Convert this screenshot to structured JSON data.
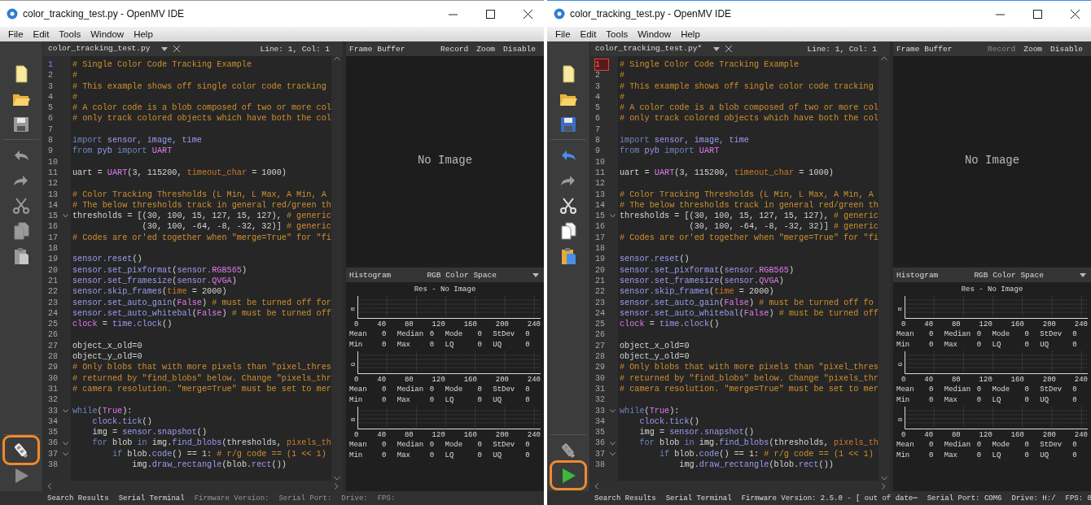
{
  "windows": [
    {
      "title": "color_tracking_test.py - OpenMV IDE",
      "active": false,
      "menu": [
        "File",
        "Edit",
        "Tools",
        "Window",
        "Help"
      ],
      "toolbar_top": [
        {
          "kind": "new-file",
          "enabled": true
        },
        {
          "kind": "open-folder",
          "enabled": true
        },
        {
          "kind": "save",
          "enabled": false
        },
        {
          "kind": "undo",
          "enabled": false
        },
        {
          "kind": "redo",
          "enabled": false
        },
        {
          "kind": "cut",
          "enabled": false
        },
        {
          "kind": "copy",
          "enabled": false
        },
        {
          "kind": "paste",
          "enabled": false
        }
      ],
      "toolbar_bottom": [
        {
          "kind": "connect",
          "enabled": true,
          "highlighted": true
        },
        {
          "kind": "run",
          "enabled": false,
          "highlighted": false
        }
      ],
      "editor": {
        "tab": "color_tracking_test.py",
        "position": "Line: 1, Col: 1",
        "focused": false,
        "lines": [
          {
            "number": "1",
            "current": true,
            "fold": false,
            "segments": [
              {
                "kind": "comment",
                "text": "# Single Color Code Tracking Example"
              }
            ]
          },
          {
            "number": "2",
            "current": false,
            "fold": false,
            "segments": [
              {
                "kind": "comment",
                "text": "#"
              }
            ]
          },
          {
            "number": "3",
            "current": false,
            "fold": false,
            "segments": [
              {
                "kind": "comment",
                "text": "# This example shows off single color code tracking"
              }
            ]
          },
          {
            "number": "4",
            "current": false,
            "fold": false,
            "segments": [
              {
                "kind": "comment",
                "text": "#"
              }
            ]
          },
          {
            "number": "5",
            "current": false,
            "fold": false,
            "segments": [
              {
                "kind": "comment",
                "text": "# A color code is a blob composed of two or more col"
              }
            ]
          },
          {
            "number": "6",
            "current": false,
            "fold": false,
            "segments": [
              {
                "kind": "comment",
                "text": "# only track colored objects which have both the col"
              }
            ]
          },
          {
            "number": "7",
            "current": false,
            "fold": false
          },
          {
            "number": "8",
            "current": false,
            "fold": false,
            "segments": [
              {
                "kind": "keyword",
                "text": "import"
              },
              {
                "kind": "module",
                "text": " sensor, image, time"
              }
            ]
          },
          {
            "number": "9",
            "current": false,
            "fold": false,
            "segments": [
              {
                "kind": "keyword",
                "text": "from"
              },
              {
                "kind": "module",
                "text": " pyb"
              },
              {
                "kind": "keyword",
                "text": " import"
              },
              {
                "kind": "constant",
                "text": " UART"
              }
            ]
          },
          {
            "number": "10",
            "current": false,
            "fold": false
          },
          {
            "number": "11",
            "current": false,
            "fold": false,
            "segments": [
              {
                "kind": "plain",
                "text": "uart = "
              },
              {
                "kind": "constant",
                "text": "UART"
              },
              {
                "kind": "plain",
                "text": "(3, 115200, "
              },
              {
                "kind": "param",
                "text": "timeout_char"
              },
              {
                "kind": "plain",
                "text": " = 1000)"
              }
            ]
          },
          {
            "number": "12",
            "current": false,
            "fold": false
          },
          {
            "number": "13",
            "current": false,
            "fold": false,
            "segments": [
              {
                "kind": "comment",
                "text": "# Color Tracking Thresholds (L Min, L Max, A Min, A"
              }
            ]
          },
          {
            "number": "14",
            "current": false,
            "fold": false,
            "segments": [
              {
                "kind": "comment",
                "text": "# The below thresholds track in general red/green th"
              }
            ]
          },
          {
            "number": "15",
            "current": false,
            "fold": true,
            "segments": [
              {
                "kind": "plain",
                "text": "thresholds = [(30, 100, 15, 127, 15, 127), "
              },
              {
                "kind": "comment",
                "text": "# generic"
              }
            ]
          },
          {
            "number": "16",
            "current": false,
            "fold": false,
            "segments": [
              {
                "kind": "plain",
                "text": "              (30, 100, -64, -8, -32, 32)] "
              },
              {
                "kind": "comment",
                "text": "# generic"
              }
            ]
          },
          {
            "number": "17",
            "current": false,
            "fold": false,
            "segments": [
              {
                "kind": "comment",
                "text": "# Codes are or'ed together when \"merge=True\" for \"fi"
              }
            ]
          },
          {
            "number": "18",
            "current": false,
            "fold": false
          },
          {
            "number": "19",
            "current": false,
            "fold": false,
            "segments": [
              {
                "kind": "module",
                "text": "sensor.reset"
              },
              {
                "kind": "plain",
                "text": "()"
              }
            ]
          },
          {
            "number": "20",
            "current": false,
            "fold": false,
            "segments": [
              {
                "kind": "module",
                "text": "sensor.set_pixformat"
              },
              {
                "kind": "plain",
                "text": "("
              },
              {
                "kind": "module",
                "text": "sensor."
              },
              {
                "kind": "constant",
                "text": "RGB565"
              },
              {
                "kind": "plain",
                "text": ")"
              }
            ]
          },
          {
            "number": "21",
            "current": false,
            "fold": false,
            "segments": [
              {
                "kind": "module",
                "text": "sensor.set_framesize"
              },
              {
                "kind": "plain",
                "text": "("
              },
              {
                "kind": "module",
                "text": "sensor."
              },
              {
                "kind": "constant",
                "text": "QVGA"
              },
              {
                "kind": "plain",
                "text": ")"
              }
            ]
          },
          {
            "number": "22",
            "current": false,
            "fold": false,
            "segments": [
              {
                "kind": "module",
                "text": "sensor.skip_frames"
              },
              {
                "kind": "plain",
                "text": "("
              },
              {
                "kind": "param",
                "text": "time"
              },
              {
                "kind": "plain",
                "text": " = 2000)"
              }
            ]
          },
          {
            "number": "23",
            "current": false,
            "fold": false,
            "segments": [
              {
                "kind": "module",
                "text": "sensor.set_auto_gain"
              },
              {
                "kind": "plain",
                "text": "("
              },
              {
                "kind": "constant",
                "text": "False"
              },
              {
                "kind": "plain",
                "text": ") "
              },
              {
                "kind": "comment",
                "text": "# must be turned off for"
              }
            ]
          },
          {
            "number": "24",
            "current": false,
            "fold": false,
            "segments": [
              {
                "kind": "module",
                "text": "sensor.set_auto_whitebal"
              },
              {
                "kind": "plain",
                "text": "("
              },
              {
                "kind": "constant",
                "text": "False"
              },
              {
                "kind": "plain",
                "text": ") "
              },
              {
                "kind": "comment",
                "text": "# must be turned off"
              }
            ]
          },
          {
            "number": "25",
            "current": false,
            "fold": false,
            "segments": [
              {
                "kind": "constant",
                "text": "clock"
              },
              {
                "kind": "plain",
                "text": " = "
              },
              {
                "kind": "module",
                "text": "time.clock"
              },
              {
                "kind": "plain",
                "text": "()"
              }
            ]
          },
          {
            "number": "26",
            "current": false,
            "fold": false
          },
          {
            "number": "27",
            "current": false,
            "fold": false,
            "segments": [
              {
                "kind": "plain",
                "text": "object_x_old=0"
              }
            ]
          },
          {
            "number": "28",
            "current": false,
            "fold": false,
            "segments": [
              {
                "kind": "plain",
                "text": "object_y_old=0"
              }
            ]
          },
          {
            "number": "29",
            "current": false,
            "fold": false,
            "segments": [
              {
                "kind": "comment",
                "text": "# Only blobs that with more pixels than \"pixel_thres"
              }
            ]
          },
          {
            "number": "30",
            "current": false,
            "fold": false,
            "segments": [
              {
                "kind": "comment",
                "text": "# returned by \"find_blobs\" below. Change \"pixels_thr"
              }
            ]
          },
          {
            "number": "31",
            "current": false,
            "fold": false,
            "segments": [
              {
                "kind": "comment",
                "text": "# camera resolution. \"merge=True\" must be set to mer"
              }
            ]
          },
          {
            "number": "32",
            "current": false,
            "fold": false
          },
          {
            "number": "33",
            "current": false,
            "fold": true,
            "segments": [
              {
                "kind": "keyword",
                "text": "while"
              },
              {
                "kind": "plain",
                "text": "("
              },
              {
                "kind": "constant",
                "text": "True"
              },
              {
                "kind": "plain",
                "text": "):"
              }
            ]
          },
          {
            "number": "34",
            "current": false,
            "fold": false,
            "segments": [
              {
                "kind": "module",
                "text": "    clock.tick"
              },
              {
                "kind": "plain",
                "text": "()"
              }
            ]
          },
          {
            "number": "35",
            "current": false,
            "fold": false,
            "segments": [
              {
                "kind": "plain",
                "text": "    img = "
              },
              {
                "kind": "module",
                "text": "sensor.snapshot"
              },
              {
                "kind": "plain",
                "text": "()"
              }
            ]
          },
          {
            "number": "36",
            "current": false,
            "fold": true,
            "segments": [
              {
                "kind": "keyword",
                "text": "    for"
              },
              {
                "kind": "plain",
                "text": " blob "
              },
              {
                "kind": "keyword",
                "text": "in"
              },
              {
                "kind": "plain",
                "text": " img."
              },
              {
                "kind": "module",
                "text": "find_blobs"
              },
              {
                "kind": "plain",
                "text": "(thresholds, "
              },
              {
                "kind": "param",
                "text": "pixels_th"
              }
            ]
          },
          {
            "number": "37",
            "current": false,
            "fold": true,
            "segments": [
              {
                "kind": "keyword",
                "text": "        if"
              },
              {
                "kind": "plain",
                "text": " blob."
              },
              {
                "kind": "module",
                "text": "code"
              },
              {
                "kind": "plain",
                "text": "() == 1: "
              },
              {
                "kind": "comment",
                "text": "# r/g code == (1 << 1)"
              }
            ]
          },
          {
            "number": "38",
            "current": false,
            "fold": false,
            "segments": [
              {
                "kind": "plain",
                "text": "            img."
              },
              {
                "kind": "module",
                "text": "draw_rectangle"
              },
              {
                "kind": "plain",
                "text": "(blob."
              },
              {
                "kind": "module",
                "text": "rect"
              },
              {
                "kind": "plain",
                "text": "())"
              }
            ]
          }
        ]
      },
      "frame_buffer": {
        "title": "Frame Buffer",
        "actions": [
          {
            "label": "Record",
            "disabled": false
          },
          {
            "label": "Zoom",
            "disabled": false
          },
          {
            "label": "Disable",
            "disabled": false
          }
        ],
        "message": "No Image"
      },
      "histogram": {
        "title": "Histogram",
        "color_space": "RGB Color Space",
        "caption": "Res - No Image",
        "channels": [
          {
            "name": "R",
            "ticks": [
              "0",
              "40",
              "80",
              "120",
              "160",
              "200",
              "240"
            ],
            "stats": [
              {
                "label": "Mean",
                "value": "0"
              },
              {
                "label": "Median",
                "value": "0"
              },
              {
                "label": "Mode",
                "value": "0"
              },
              {
                "label": "StDev",
                "value": "0"
              },
              {
                "label": "Min",
                "value": "0"
              },
              {
                "label": "Max",
                "value": "0"
              },
              {
                "label": "LQ",
                "value": "0"
              },
              {
                "label": "UQ",
                "value": "0"
              }
            ]
          },
          {
            "name": "G",
            "ticks": [
              "0",
              "40",
              "80",
              "120",
              "160",
              "200",
              "240"
            ],
            "stats": [
              {
                "label": "Mean",
                "value": "0"
              },
              {
                "label": "Median",
                "value": "0"
              },
              {
                "label": "Mode",
                "value": "0"
              },
              {
                "label": "StDev",
                "value": "0"
              },
              {
                "label": "Min",
                "value": "0"
              },
              {
                "label": "Max",
                "value": "0"
              },
              {
                "label": "LQ",
                "value": "0"
              },
              {
                "label": "UQ",
                "value": "0"
              }
            ]
          },
          {
            "name": "B",
            "ticks": [
              "0",
              "40",
              "80",
              "120",
              "160",
              "200",
              "240"
            ],
            "stats": [
              {
                "label": "Mean",
                "value": "0"
              },
              {
                "label": "Median",
                "value": "0"
              },
              {
                "label": "Mode",
                "value": "0"
              },
              {
                "label": "StDev",
                "value": "0"
              },
              {
                "label": "Min",
                "value": "0"
              },
              {
                "label": "Max",
                "value": "0"
              },
              {
                "label": "LQ",
                "value": "0"
              },
              {
                "label": "UQ",
                "value": "0"
              }
            ]
          }
        ]
      },
      "status_bar": [
        {
          "text": "Search Results",
          "disabled": false
        },
        {
          "text": "Serial Terminal",
          "disabled": false
        },
        {
          "text": "Firmware Version:",
          "disabled": true
        },
        {
          "text": "Serial Port:",
          "disabled": true
        },
        {
          "text": "Drive:",
          "disabled": true
        },
        {
          "text": "FPS:",
          "disabled": true
        }
      ]
    },
    {
      "title": "color_tracking_test.py - OpenMV IDE",
      "active": true,
      "menu": [
        "File",
        "Edit",
        "Tools",
        "Window",
        "Help"
      ],
      "toolbar_top": [
        {
          "kind": "new-file",
          "enabled": true
        },
        {
          "kind": "open-folder",
          "enabled": true
        },
        {
          "kind": "save",
          "enabled": true
        },
        {
          "kind": "undo",
          "enabled": true
        },
        {
          "kind": "redo",
          "enabled": false
        },
        {
          "kind": "cut",
          "enabled": true
        },
        {
          "kind": "copy",
          "enabled": true
        },
        {
          "kind": "paste",
          "enabled": true
        }
      ],
      "toolbar_bottom": [
        {
          "kind": "connect",
          "enabled": false,
          "highlighted": false
        },
        {
          "kind": "run",
          "enabled": true,
          "highlighted": true
        }
      ],
      "editor": {
        "tab": "color_tracking_test.py*",
        "position": "Line: 1, Col: 1",
        "focused": true,
        "lines": [
          {
            "number": "1",
            "current": true,
            "fold": false,
            "segments": [
              {
                "kind": "comment",
                "text": "# Single Color Code Tracking Example"
              }
            ]
          },
          {
            "number": "2",
            "current": false,
            "fold": false,
            "segments": [
              {
                "kind": "comment",
                "text": "#"
              }
            ]
          },
          {
            "number": "3",
            "current": false,
            "fold": false,
            "segments": [
              {
                "kind": "comment",
                "text": "# This example shows off single color code tracking"
              }
            ]
          },
          {
            "number": "4",
            "current": false,
            "fold": false,
            "segments": [
              {
                "kind": "comment",
                "text": "#"
              }
            ]
          },
          {
            "number": "5",
            "current": false,
            "fold": false,
            "segments": [
              {
                "kind": "comment",
                "text": "# A color code is a blob composed of two or more col"
              }
            ]
          },
          {
            "number": "6",
            "current": false,
            "fold": false,
            "segments": [
              {
                "kind": "comment",
                "text": "# only track colored objects which have both the col"
              }
            ]
          },
          {
            "number": "7",
            "current": false,
            "fold": false
          },
          {
            "number": "8",
            "current": false,
            "fold": false,
            "segments": [
              {
                "kind": "keyword",
                "text": "import"
              },
              {
                "kind": "module",
                "text": " sensor, image, time"
              }
            ]
          },
          {
            "number": "9",
            "current": false,
            "fold": false,
            "segments": [
              {
                "kind": "keyword",
                "text": "from"
              },
              {
                "kind": "module",
                "text": " pyb"
              },
              {
                "kind": "keyword",
                "text": " import"
              },
              {
                "kind": "constant",
                "text": " UART"
              }
            ]
          },
          {
            "number": "10",
            "current": false,
            "fold": false
          },
          {
            "number": "11",
            "current": false,
            "fold": false,
            "segments": [
              {
                "kind": "plain",
                "text": "uart = "
              },
              {
                "kind": "constant",
                "text": "UART"
              },
              {
                "kind": "plain",
                "text": "(3, 115200, "
              },
              {
                "kind": "param",
                "text": "timeout_char"
              },
              {
                "kind": "plain",
                "text": " = 1000)"
              }
            ]
          },
          {
            "number": "12",
            "current": false,
            "fold": false
          },
          {
            "number": "13",
            "current": false,
            "fold": false,
            "segments": [
              {
                "kind": "comment",
                "text": "# Color Tracking Thresholds (L Min, L Max, A Min, A"
              }
            ]
          },
          {
            "number": "14",
            "current": false,
            "fold": false,
            "segments": [
              {
                "kind": "comment",
                "text": "# The below thresholds track in general red/green th"
              }
            ]
          },
          {
            "number": "15",
            "current": false,
            "fold": true,
            "segments": [
              {
                "kind": "plain",
                "text": "thresholds = [(30, 100, 15, 127, 15, 127), "
              },
              {
                "kind": "comment",
                "text": "# generic"
              }
            ]
          },
          {
            "number": "16",
            "current": false,
            "fold": false,
            "segments": [
              {
                "kind": "plain",
                "text": "              (30, 100, -64, -8, -32, 32)] "
              },
              {
                "kind": "comment",
                "text": "# generic"
              }
            ]
          },
          {
            "number": "17",
            "current": false,
            "fold": false,
            "segments": [
              {
                "kind": "comment",
                "text": "# Codes are or'ed together when \"merge=True\" for \"fi"
              }
            ]
          },
          {
            "number": "18",
            "current": false,
            "fold": false
          },
          {
            "number": "19",
            "current": false,
            "fold": false,
            "segments": [
              {
                "kind": "module",
                "text": "sensor.reset"
              },
              {
                "kind": "plain",
                "text": "()"
              }
            ]
          },
          {
            "number": "20",
            "current": false,
            "fold": false,
            "segments": [
              {
                "kind": "module",
                "text": "sensor.set_pixformat"
              },
              {
                "kind": "plain",
                "text": "("
              },
              {
                "kind": "module",
                "text": "sensor."
              },
              {
                "kind": "constant",
                "text": "RGB565"
              },
              {
                "kind": "plain",
                "text": ")"
              }
            ]
          },
          {
            "number": "21",
            "current": false,
            "fold": false,
            "segments": [
              {
                "kind": "module",
                "text": "sensor.set_framesize"
              },
              {
                "kind": "plain",
                "text": "("
              },
              {
                "kind": "module",
                "text": "sensor."
              },
              {
                "kind": "constant",
                "text": "QVGA"
              },
              {
                "kind": "plain",
                "text": ")"
              }
            ]
          },
          {
            "number": "22",
            "current": false,
            "fold": false,
            "segments": [
              {
                "kind": "module",
                "text": "sensor.skip_frames"
              },
              {
                "kind": "plain",
                "text": "("
              },
              {
                "kind": "param",
                "text": "time"
              },
              {
                "kind": "plain",
                "text": " = 2000)"
              }
            ]
          },
          {
            "number": "23",
            "current": false,
            "fold": false,
            "segments": [
              {
                "kind": "module",
                "text": "sensor.set_auto_gain"
              },
              {
                "kind": "plain",
                "text": "("
              },
              {
                "kind": "constant",
                "text": "False"
              },
              {
                "kind": "plain",
                "text": ") "
              },
              {
                "kind": "comment",
                "text": "# must be turned off fo"
              }
            ]
          },
          {
            "number": "24",
            "current": false,
            "fold": false,
            "segments": [
              {
                "kind": "module",
                "text": "sensor.set_auto_whitebal"
              },
              {
                "kind": "plain",
                "text": "("
              },
              {
                "kind": "constant",
                "text": "False"
              },
              {
                "kind": "plain",
                "text": ") "
              },
              {
                "kind": "comment",
                "text": "# must be turned off"
              }
            ]
          },
          {
            "number": "25",
            "current": false,
            "fold": false,
            "segments": [
              {
                "kind": "constant",
                "text": "clock"
              },
              {
                "kind": "plain",
                "text": " = "
              },
              {
                "kind": "module",
                "text": "time.clock"
              },
              {
                "kind": "plain",
                "text": "()"
              }
            ]
          },
          {
            "number": "26",
            "current": false,
            "fold": false
          },
          {
            "number": "27",
            "current": false,
            "fold": false,
            "segments": [
              {
                "kind": "plain",
                "text": "object_x_old=0"
              }
            ]
          },
          {
            "number": "28",
            "current": false,
            "fold": false,
            "segments": [
              {
                "kind": "plain",
                "text": "object_y_old=0"
              }
            ]
          },
          {
            "number": "29",
            "current": false,
            "fold": false,
            "segments": [
              {
                "kind": "comment",
                "text": "# Only blobs that with more pixels than \"pixel_thres"
              }
            ]
          },
          {
            "number": "30",
            "current": false,
            "fold": false,
            "segments": [
              {
                "kind": "comment",
                "text": "# returned by \"find_blobs\" below. Change \"pixels_thr"
              }
            ]
          },
          {
            "number": "31",
            "current": false,
            "fold": false,
            "segments": [
              {
                "kind": "comment",
                "text": "# camera resolution. \"merge=True\" must be set to mer"
              }
            ]
          },
          {
            "number": "32",
            "current": false,
            "fold": false
          },
          {
            "number": "33",
            "current": false,
            "fold": true,
            "segments": [
              {
                "kind": "keyword",
                "text": "while"
              },
              {
                "kind": "plain",
                "text": "("
              },
              {
                "kind": "constant",
                "text": "True"
              },
              {
                "kind": "plain",
                "text": "):"
              }
            ]
          },
          {
            "number": "34",
            "current": false,
            "fold": false,
            "segments": [
              {
                "kind": "module",
                "text": "    clock.tick"
              },
              {
                "kind": "plain",
                "text": "()"
              }
            ]
          },
          {
            "number": "35",
            "current": false,
            "fold": false,
            "segments": [
              {
                "kind": "plain",
                "text": "    img = "
              },
              {
                "kind": "module",
                "text": "sensor.snapshot"
              },
              {
                "kind": "plain",
                "text": "()"
              }
            ]
          },
          {
            "number": "36",
            "current": false,
            "fold": true,
            "segments": [
              {
                "kind": "keyword",
                "text": "    for"
              },
              {
                "kind": "plain",
                "text": " blob "
              },
              {
                "kind": "keyword",
                "text": "in"
              },
              {
                "kind": "plain",
                "text": " img."
              },
              {
                "kind": "module",
                "text": "find_blobs"
              },
              {
                "kind": "plain",
                "text": "(thresholds, "
              },
              {
                "kind": "param",
                "text": "pixels_th"
              }
            ]
          },
          {
            "number": "37",
            "current": false,
            "fold": true,
            "segments": [
              {
                "kind": "keyword",
                "text": "        if"
              },
              {
                "kind": "plain",
                "text": " blob."
              },
              {
                "kind": "module",
                "text": "code"
              },
              {
                "kind": "plain",
                "text": "() == 1: "
              },
              {
                "kind": "comment",
                "text": "# r/g code == (1 << 1)"
              }
            ]
          },
          {
            "number": "38",
            "current": false,
            "fold": false,
            "segments": [
              {
                "kind": "plain",
                "text": "            img."
              },
              {
                "kind": "module",
                "text": "draw_rectangle"
              },
              {
                "kind": "plain",
                "text": "(blob."
              },
              {
                "kind": "module",
                "text": "rect"
              },
              {
                "kind": "plain",
                "text": "())"
              }
            ]
          }
        ]
      },
      "frame_buffer": {
        "title": "Frame Buffer",
        "actions": [
          {
            "label": "Record",
            "disabled": true
          },
          {
            "label": "Zoom",
            "disabled": false
          },
          {
            "label": "Disable",
            "disabled": false
          }
        ],
        "message": "No Image"
      },
      "histogram": {
        "title": "Histogram",
        "color_space": "RGB Color Space",
        "caption": "Res - No Image",
        "channels": [
          {
            "name": "R",
            "ticks": [
              "0",
              "40",
              "80",
              "120",
              "160",
              "200",
              "240"
            ],
            "stats": [
              {
                "label": "Mean",
                "value": "0"
              },
              {
                "label": "Median",
                "value": "0"
              },
              {
                "label": "Mode",
                "value": "0"
              },
              {
                "label": "StDev",
                "value": "0"
              },
              {
                "label": "Min",
                "value": "0"
              },
              {
                "label": "Max",
                "value": "0"
              },
              {
                "label": "LQ",
                "value": "0"
              },
              {
                "label": "UQ",
                "value": "0"
              }
            ]
          },
          {
            "name": "G",
            "ticks": [
              "0",
              "40",
              "80",
              "120",
              "160",
              "200",
              "240"
            ],
            "stats": [
              {
                "label": "Mean",
                "value": "0"
              },
              {
                "label": "Median",
                "value": "0"
              },
              {
                "label": "Mode",
                "value": "0"
              },
              {
                "label": "StDev",
                "value": "0"
              },
              {
                "label": "Min",
                "value": "0"
              },
              {
                "label": "Max",
                "value": "0"
              },
              {
                "label": "LQ",
                "value": "0"
              },
              {
                "label": "UQ",
                "value": "0"
              }
            ]
          },
          {
            "name": "B",
            "ticks": [
              "0",
              "40",
              "80",
              "120",
              "160",
              "200",
              "240"
            ],
            "stats": [
              {
                "label": "Mean",
                "value": "0"
              },
              {
                "label": "Median",
                "value": "0"
              },
              {
                "label": "Mode",
                "value": "0"
              },
              {
                "label": "StDev",
                "value": "0"
              },
              {
                "label": "Min",
                "value": "0"
              },
              {
                "label": "Max",
                "value": "0"
              },
              {
                "label": "LQ",
                "value": "0"
              },
              {
                "label": "UQ",
                "value": "0"
              }
            ]
          }
        ]
      },
      "status_bar": [
        {
          "text": "Search Results",
          "disabled": false
        },
        {
          "text": "Serial Terminal",
          "disabled": false
        },
        {
          "text": "Firmware Version: 2.5.0 - [ out of date⋯",
          "disabled": false
        },
        {
          "text": "Serial Port: COM6",
          "disabled": false
        },
        {
          "text": "Drive: H:/",
          "disabled": false
        },
        {
          "text": "FPS: 0",
          "disabled": false
        }
      ]
    }
  ]
}
